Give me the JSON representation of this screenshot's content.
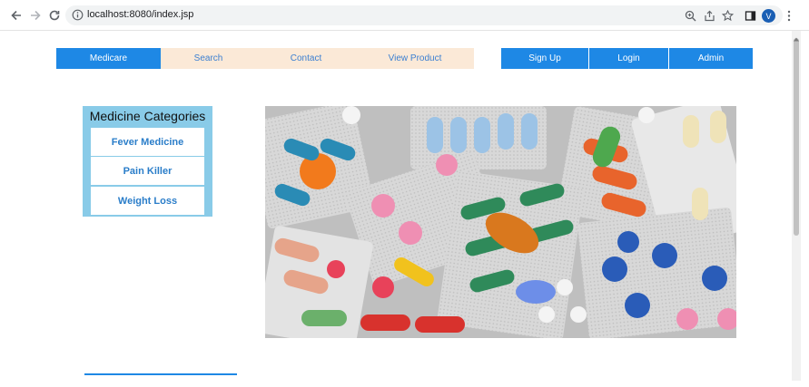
{
  "browser": {
    "url": "localhost:8080/index.jsp",
    "avatar_letter": "V"
  },
  "nav": {
    "left_items": [
      {
        "label": "Medicare"
      },
      {
        "label": "Search"
      },
      {
        "label": "Contact"
      },
      {
        "label": "View Product"
      }
    ],
    "right_items": [
      {
        "label": "Sign Up"
      },
      {
        "label": "Login"
      },
      {
        "label": "Admin"
      }
    ]
  },
  "categories": {
    "title": "Medicine Categories",
    "items": [
      {
        "label": "Fever Medicine"
      },
      {
        "label": "Pain Killer"
      },
      {
        "label": "Weight Loss"
      }
    ]
  },
  "colors": {
    "primary": "#1e88e5",
    "nav_bg": "#fbe9d7",
    "sidebar_bg": "#89cbe8",
    "link": "#2a7dc9"
  },
  "icons": {
    "back": "arrow-left-icon",
    "forward": "arrow-right-icon",
    "reload": "reload-icon",
    "info": "info-icon",
    "zoom": "zoom-icon",
    "share": "share-icon",
    "bookmark": "star-icon",
    "sidebar": "side-panel-icon",
    "menu": "kebab-menu-icon"
  }
}
